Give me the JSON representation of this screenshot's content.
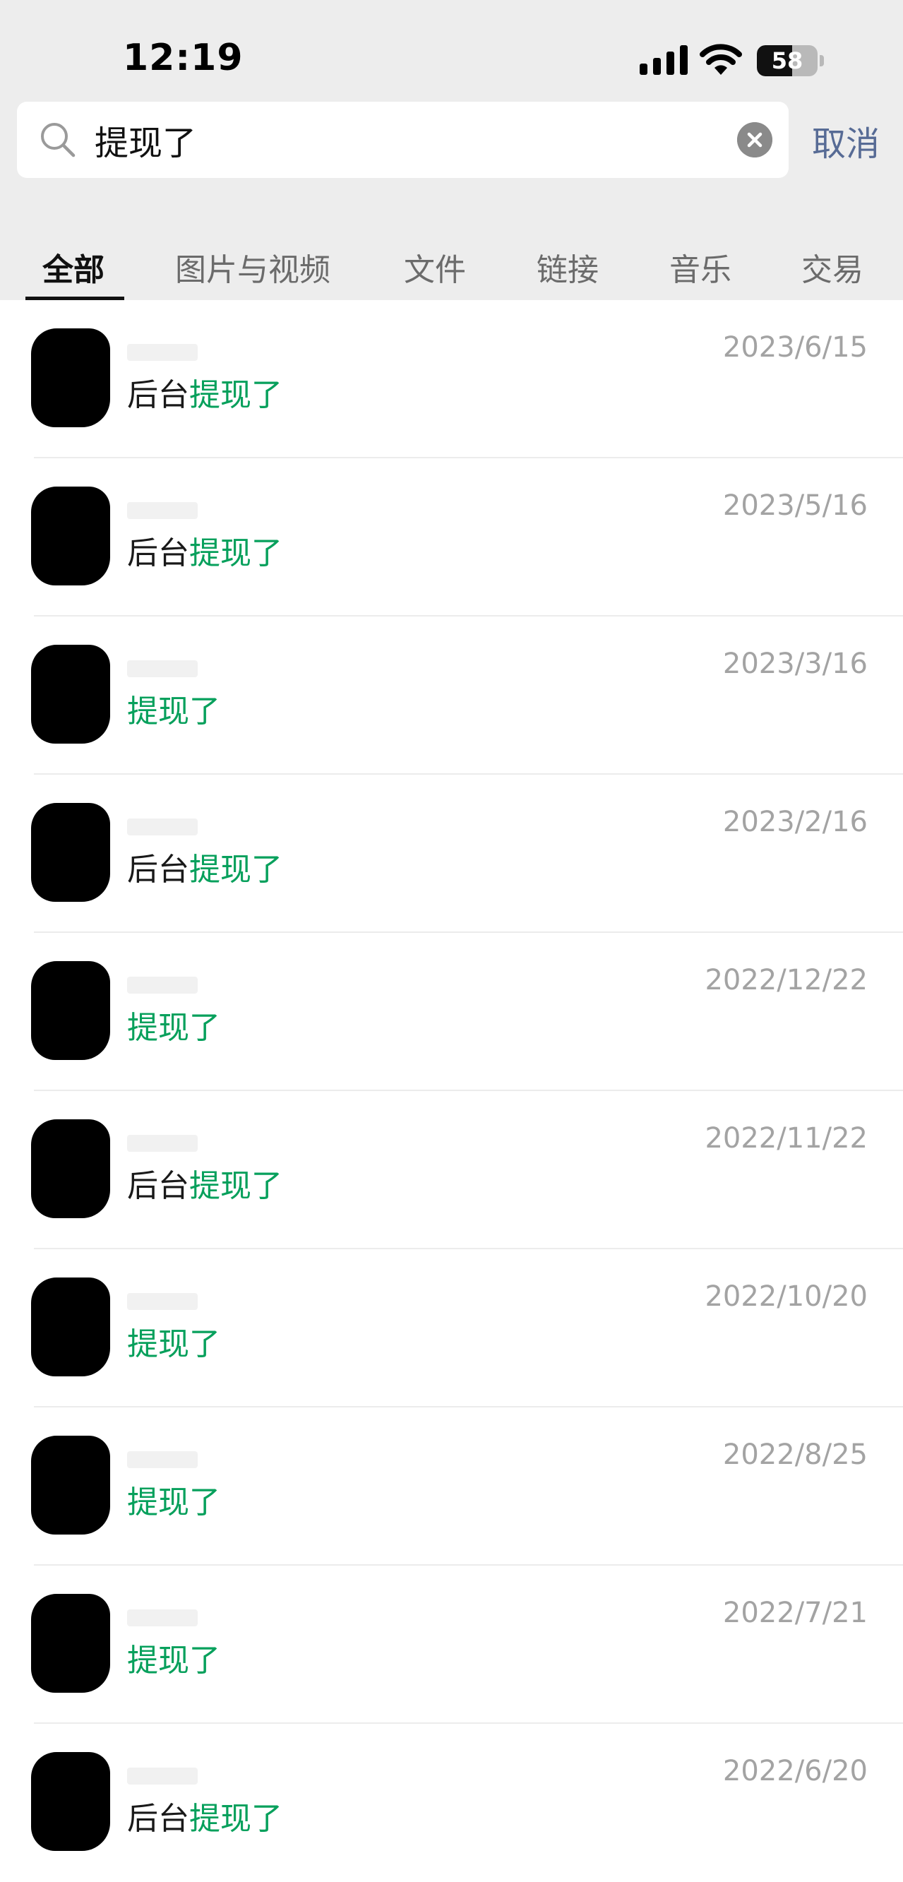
{
  "status_bar": {
    "time": "12:19",
    "battery": "58"
  },
  "search": {
    "query": "提现了",
    "cancel_label": "取消"
  },
  "tabs": [
    {
      "label": "全部",
      "active": true
    },
    {
      "label": "图片与视频",
      "active": false
    },
    {
      "label": "文件",
      "active": false
    },
    {
      "label": "链接",
      "active": false
    },
    {
      "label": "音乐",
      "active": false
    },
    {
      "label": "交易",
      "active": false
    }
  ],
  "results": [
    {
      "date": "2023/6/15",
      "prefix": "后台",
      "match": "提现了"
    },
    {
      "date": "2023/5/16",
      "prefix": "后台",
      "match": "提现了"
    },
    {
      "date": "2023/3/16",
      "prefix": "",
      "match": "提现了"
    },
    {
      "date": "2023/2/16",
      "prefix": "后台",
      "match": "提现了"
    },
    {
      "date": "2022/12/22",
      "prefix": "",
      "match": "提现了"
    },
    {
      "date": "2022/11/22",
      "prefix": "后台",
      "match": "提现了"
    },
    {
      "date": "2022/10/20",
      "prefix": "",
      "match": "提现了"
    },
    {
      "date": "2022/8/25",
      "prefix": "",
      "match": "提现了"
    },
    {
      "date": "2022/7/21",
      "prefix": "",
      "match": "提现了"
    },
    {
      "date": "2022/6/20",
      "prefix": "后台",
      "match": "提现了"
    }
  ],
  "colors": {
    "highlight": "#07a05c",
    "cancel": "#576b95",
    "date": "#a3a3a3"
  }
}
